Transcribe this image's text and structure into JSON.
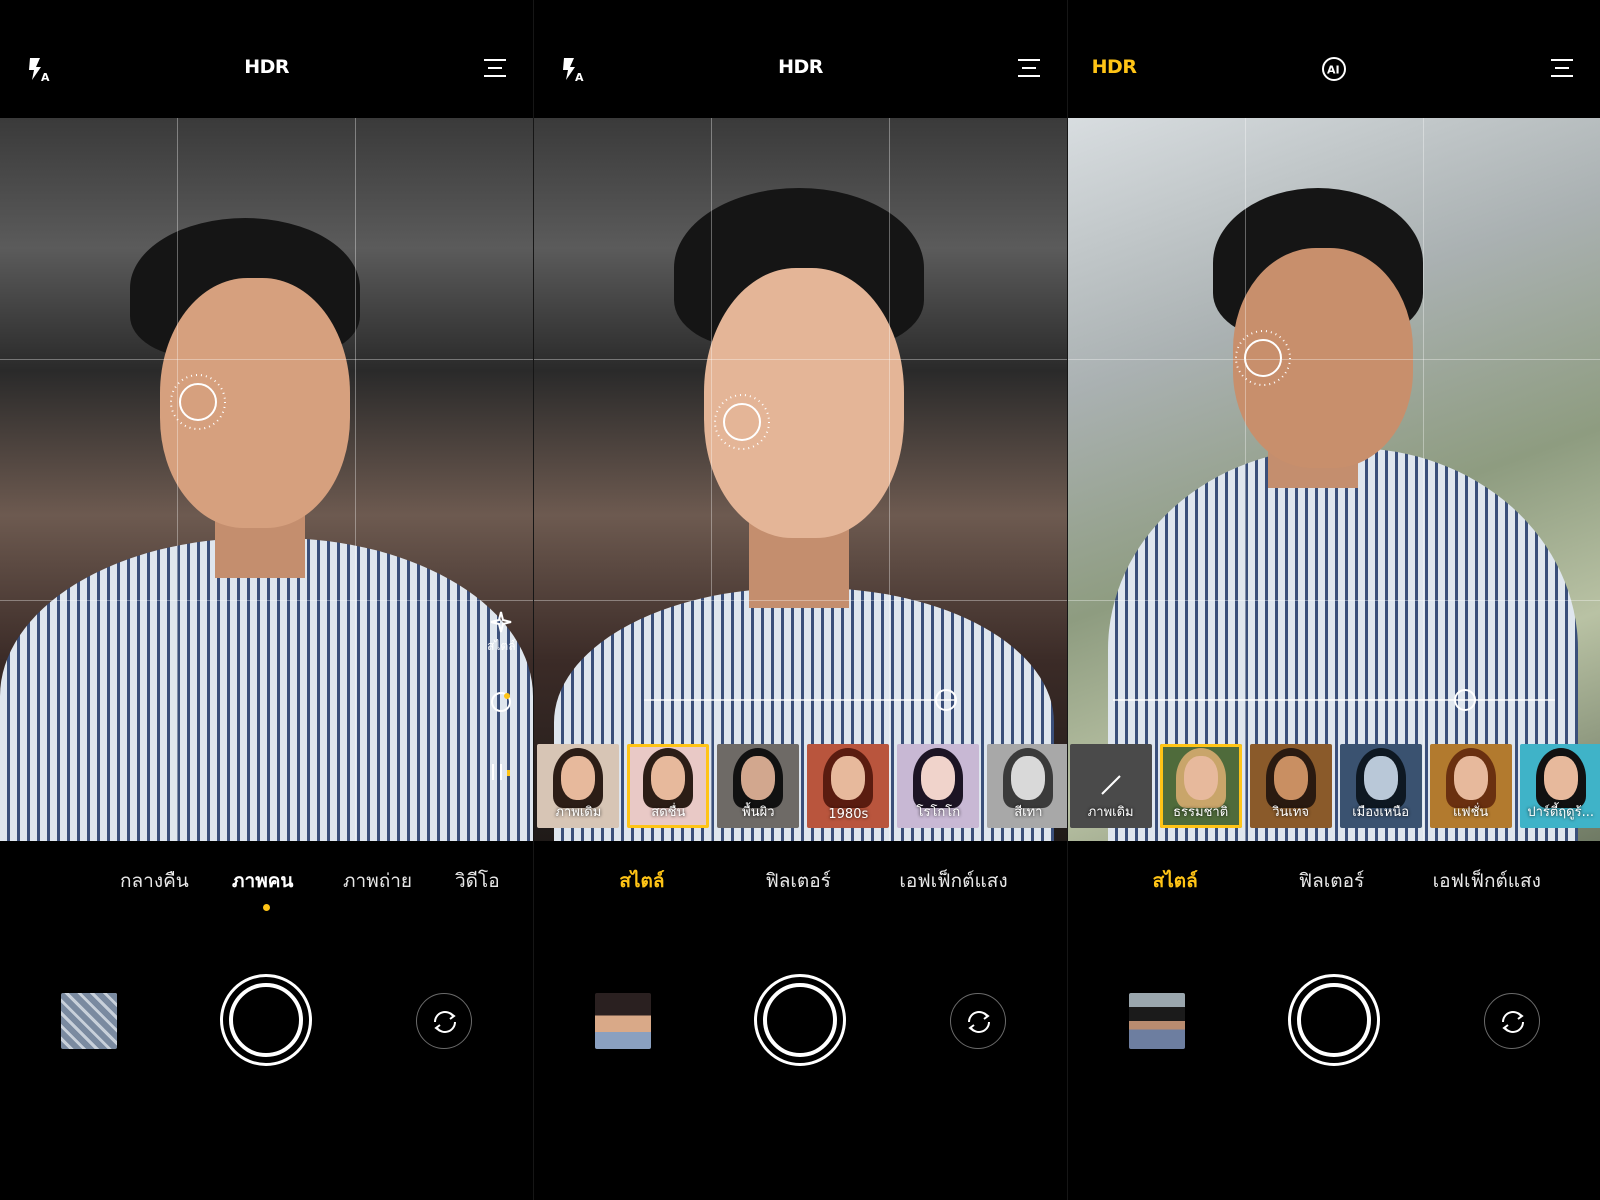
{
  "colors": {
    "accent": "#ffc416",
    "background": "#000000"
  },
  "panels": [
    {
      "topbar": {
        "left_icon": "flash-auto-icon",
        "center": "HDR",
        "right_icon": "menu-icon"
      },
      "side_tools": {
        "style_label": "สไตล์"
      },
      "modes": [
        "กลางคืน",
        "ภาพคน",
        "ภาพถ่าย",
        "วิดีโอ"
      ],
      "active_mode": "ภาพคน"
    },
    {
      "topbar": {
        "left_icon": "flash-auto-icon",
        "center": "HDR",
        "right_icon": "menu-icon"
      },
      "thumbnails": [
        "ภาพเดิม",
        "สดชื่น",
        "พื้นผิว",
        "1980s",
        "โรโกโก",
        "สีเทา"
      ],
      "selected_thumbnail": "สดชื่น",
      "modes": [
        "สไตล์",
        "ฟิลเตอร์",
        "เอฟเฟ็กต์แสง"
      ],
      "active_mode": "สไตล์"
    },
    {
      "topbar": {
        "center": "HDR",
        "center_icon": "ai-icon",
        "right_icon": "menu-icon"
      },
      "thumbnails": [
        "ภาพเดิม",
        "ธรรมชาติ",
        "วินเทจ",
        "เมืองเหนือ",
        "แฟชั่น",
        "ปาร์ตี้ฤดูร้..."
      ],
      "selected_thumbnail": "ธรรมชาติ",
      "modes": [
        "สไตล์",
        "ฟิลเตอร์",
        "เอฟเฟ็กต์แสง"
      ],
      "active_mode": "สไตล์"
    }
  ]
}
